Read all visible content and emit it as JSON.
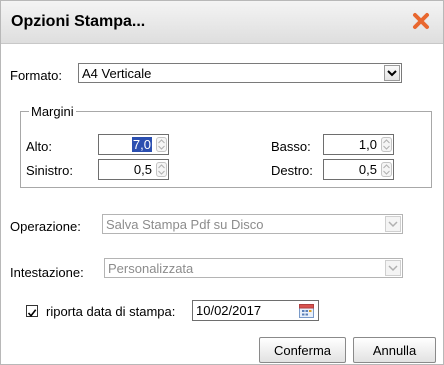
{
  "dialog": {
    "title": "Opzioni Stampa...",
    "close_icon": "close-x-icon",
    "accent_close": "#e8672f"
  },
  "format": {
    "label": "Formato:",
    "value": "A4 Verticale"
  },
  "margins": {
    "legend": "Margini",
    "top_label": "Alto:",
    "top_value": "7,0",
    "bottom_label": "Basso:",
    "bottom_value": "1,0",
    "left_label": "Sinistro:",
    "left_value": "0,5",
    "right_label": "Destro:",
    "right_value": "0,5"
  },
  "operation": {
    "label": "Operazione:",
    "value": "Salva Stampa Pdf su Disco",
    "disabled": true
  },
  "header": {
    "label": "Intestazione:",
    "value": "Personalizzata",
    "disabled": true
  },
  "print_date": {
    "checked": true,
    "label": "riporta data di stampa:",
    "value": "10/02/2017",
    "calendar_icon": "calendar-icon"
  },
  "buttons": {
    "confirm": "Conferma",
    "cancel": "Annulla"
  }
}
